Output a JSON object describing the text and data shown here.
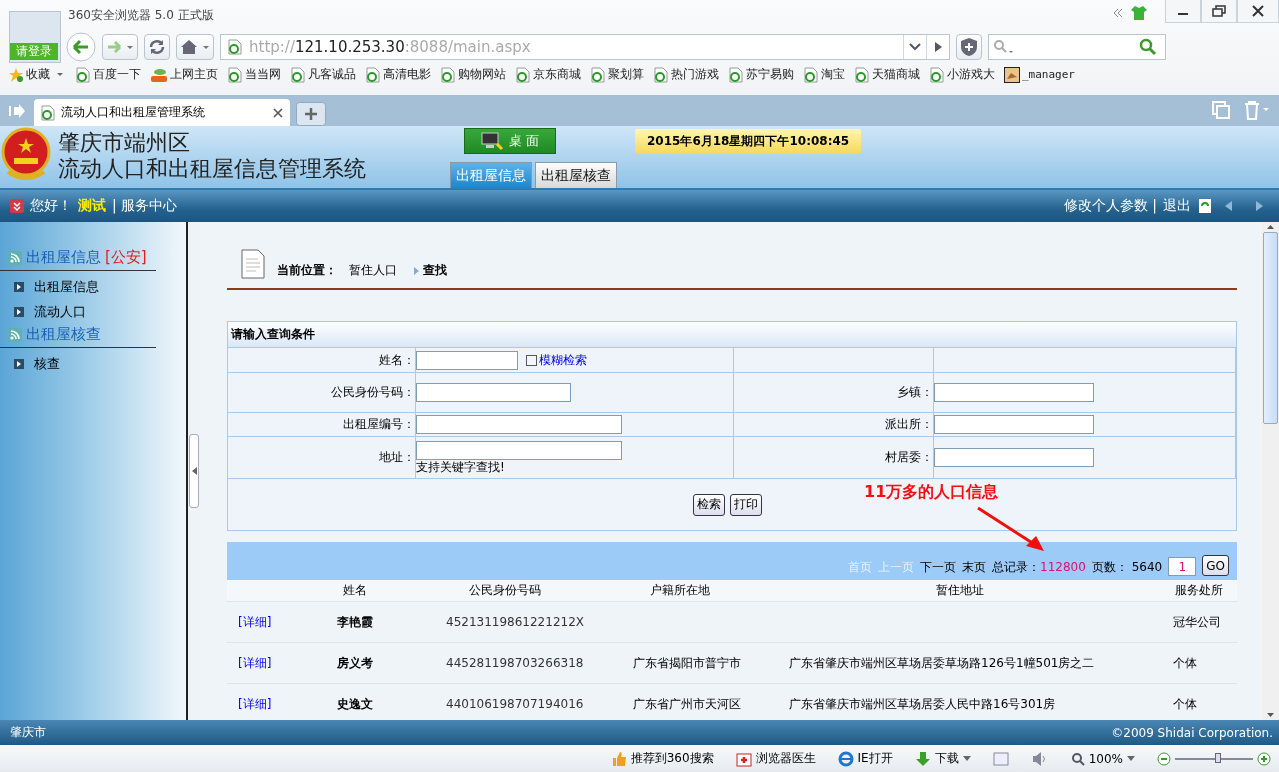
{
  "browser": {
    "title": "360安全浏览器 5.0 正式版",
    "login_label": "请登录",
    "url": {
      "scheme": "http://",
      "host": "121.10.253.30",
      "rest": ":8088/main.aspx"
    },
    "bookmarks": [
      {
        "kind": "favorites",
        "label": "收藏"
      },
      {
        "kind": "page",
        "label": "百度一下"
      },
      {
        "kind": "hao",
        "label": "上网主页"
      },
      {
        "kind": "page",
        "label": "当当网"
      },
      {
        "kind": "page",
        "label": "凡客诚品"
      },
      {
        "kind": "page",
        "label": "高清电影"
      },
      {
        "kind": "page",
        "label": "购物网站"
      },
      {
        "kind": "page",
        "label": "京东商城"
      },
      {
        "kind": "page",
        "label": "聚划算"
      },
      {
        "kind": "page",
        "label": "热门游戏"
      },
      {
        "kind": "page",
        "label": "苏宁易购"
      },
      {
        "kind": "page",
        "label": "淘宝"
      },
      {
        "kind": "page",
        "label": "天猫商城"
      },
      {
        "kind": "page",
        "label": "小游戏大"
      },
      {
        "kind": "image",
        "label": "_manager"
      }
    ],
    "tab": {
      "title": "流动人口和出租屋管理系统"
    },
    "status_items": [
      {
        "kind": "thumb",
        "label": "推荐到360搜索"
      },
      {
        "kind": "medkit",
        "label": "浏览器医生"
      },
      {
        "kind": "ie",
        "label": "IE打开"
      },
      {
        "kind": "download",
        "label": "下载"
      }
    ],
    "zoom": "100%",
    "zoom_slider": {
      "level": 0.55
    }
  },
  "app": {
    "title_lines": [
      "肇庆市端州区",
      "流动人口和出租屋信息管理系统"
    ],
    "desktop_button": "桌 面",
    "datetime": "2015年6月18星期四下午10:08:45",
    "tabs": [
      {
        "label": "出租屋信息",
        "selected": true
      },
      {
        "label": "出租屋核查",
        "selected": false
      }
    ],
    "greeting": "您好！",
    "user": "测试",
    "service_link": "| 服务中心",
    "settings_link": "修改个人参数 |",
    "logout_link": "退出",
    "sidebar": [
      {
        "title": "出租屋信息",
        "tag": "[公安]",
        "items": [
          "出租屋信息",
          "流动人口"
        ]
      },
      {
        "title": "出租屋核查",
        "items": [
          "核查"
        ]
      }
    ],
    "breadcrumb": {
      "label": "当前位置：",
      "path": "暂住人口",
      "current": "查找"
    },
    "form": {
      "title": "请输入查询条件",
      "rows": [
        {
          "left": {
            "label": "姓名：",
            "kind": "short",
            "option": {
              "label": "模糊检索",
              "checked": false
            }
          }
        },
        {
          "left": {
            "label": "公民身份号码：",
            "kind": "medium"
          },
          "right": {
            "label": "乡镇："
          }
        },
        {
          "left": {
            "label": "出租屋编号：",
            "kind": "long"
          },
          "right": {
            "label": "派出所："
          }
        },
        {
          "left": {
            "label": "地址：",
            "kind": "long",
            "hint": "支持关键字查找!"
          },
          "right": {
            "label": "村居委："
          }
        }
      ],
      "buttons": [
        "检索",
        "打印"
      ]
    },
    "annotation": "11万多的人口信息",
    "pager": {
      "links": [
        {
          "label": "首页",
          "disabled": true
        },
        {
          "label": "上一页",
          "disabled": true
        },
        {
          "label": "下一页",
          "disabled": false
        },
        {
          "label": "末页",
          "disabled": false
        }
      ],
      "total_label": "总记录：",
      "total": "112800",
      "pages_label": "页数：",
      "pages": "5640",
      "page": "1",
      "go": "GO"
    },
    "table": {
      "columns": [
        "姓名",
        "公民身份号码",
        "户籍所在地",
        "暂住地址",
        "服务处所"
      ],
      "rows": [
        {
          "link": "[详细]",
          "cells": [
            "李艳霞",
            "45213119861221212X",
            "",
            "",
            "冠华公司"
          ]
        },
        {
          "link": "[详细]",
          "cells": [
            "房义考",
            "445281198703266318",
            "广东省揭阳市普宁市",
            "广东省肇庆市端州区草场居委草场路126号1幢501房之二",
            "个体"
          ]
        },
        {
          "link": "[详细]",
          "cells": [
            "史逸文",
            "440106198707194016",
            "广东省广州市天河区",
            "广东省肇庆市端州区草场居委人民中路16号301房",
            "个体"
          ]
        }
      ]
    },
    "footer": {
      "region": "肇庆市",
      "copyright": "©2009 Shidai Corporation."
    }
  }
}
